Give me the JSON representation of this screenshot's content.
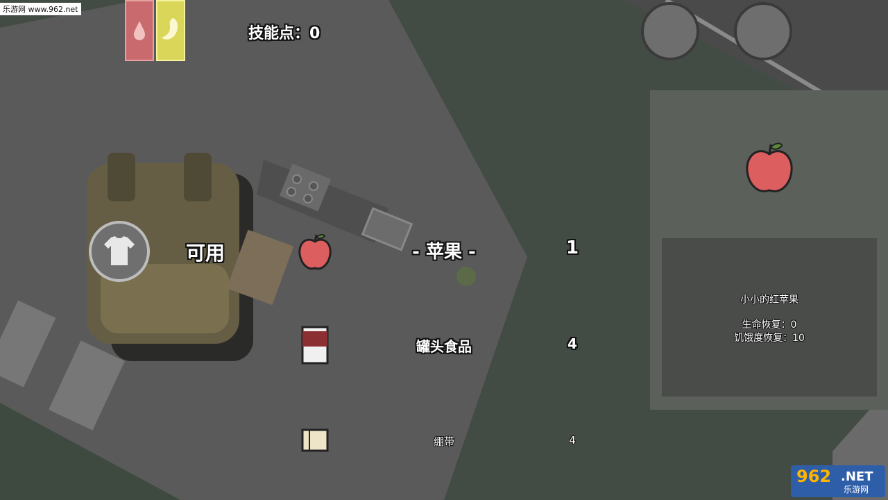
{
  "watermark": {
    "top_text": "乐游网 www.962.net",
    "logo_number": "962",
    "logo_net": ".NET",
    "logo_cn": "乐游网"
  },
  "stats": {
    "health_color": "#c96b6e",
    "hunger_color": "#d9d65a"
  },
  "hud": {
    "skill_points_label": "技能点：0"
  },
  "inventory": {
    "tab_label": "可用",
    "items": [
      {
        "name": "- 苹果 -",
        "quantity": "1",
        "icon": "apple-icon",
        "selected": true
      },
      {
        "name": "罐头食品",
        "quantity": "4",
        "icon": "canned-food-icon",
        "selected": false
      },
      {
        "name": "绷带",
        "quantity": "4",
        "icon": "bandage-icon",
        "selected": false
      }
    ]
  },
  "detail": {
    "icon": "apple-icon",
    "description": "小小的红苹果",
    "health_restore": "生命恢复：0",
    "hunger_restore": "饥饿度恢复：10"
  },
  "colors": {
    "accent_red": "#dc5e5e",
    "panel": "#5b605b"
  }
}
